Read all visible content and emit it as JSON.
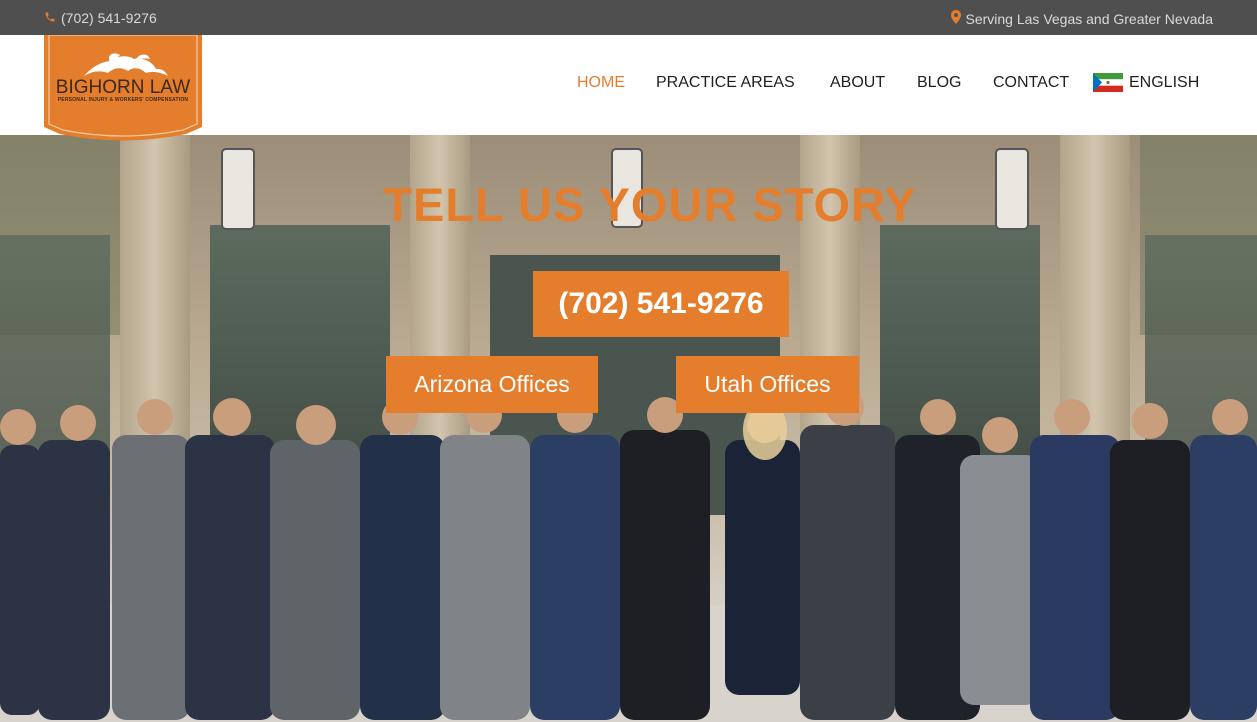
{
  "topbar": {
    "phone": "(702) 541-9276",
    "phone_icon": "phone-icon",
    "service_area": "Serving Las Vegas and Greater Nevada",
    "service_icon": "map-pin-icon"
  },
  "logo": {
    "title": "BIGHORN LAW",
    "subtitle": "PERSONAL INJURY & WORKERS' COMPENSATION"
  },
  "nav": {
    "items": [
      {
        "label": "HOME",
        "active": true
      },
      {
        "label": "PRACTICE AREAS",
        "active": false
      },
      {
        "label": "ABOUT",
        "active": false
      },
      {
        "label": "BLOG",
        "active": false
      },
      {
        "label": "CONTACT",
        "active": false
      }
    ],
    "language": "ENGLISH",
    "language_icon": "flag-icon"
  },
  "hero": {
    "headline": "TELL US YOUR STORY",
    "phone_button": "(702) 541-9276",
    "arizona_button": "Arizona Offices",
    "utah_button": "Utah Offices"
  },
  "colors": {
    "accent": "#e47e2c",
    "topbar_bg": "#4f4f4f",
    "text_dark": "#1f1f1f"
  }
}
